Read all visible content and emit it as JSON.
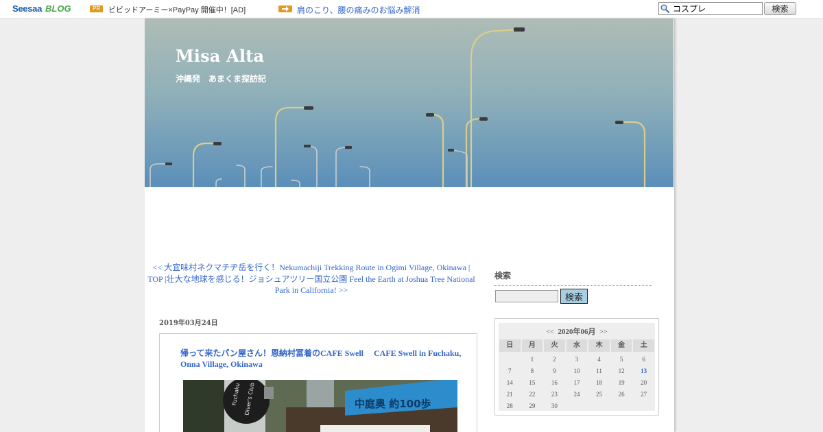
{
  "topbar": {
    "logo_seesaa": "Seesaa",
    "logo_blog": "BLOG",
    "pr_badge": "PR",
    "ad_text": "ビビッドアーミー×PayPay 開催中！[AD]",
    "ad_link": "肩のこり、腰の痛みのお悩み解消",
    "search_value": "コスプレ",
    "search_button": "検索"
  },
  "header": {
    "title": "Misa Alta",
    "description": "沖縄発　あまくま探訪記"
  },
  "nav": {
    "prev": "<< 大宜味村ネクマチヂ岳を行く！Nekumachiji Trekking Route in Ogimi Village, Okinawa",
    "sep1": " | ",
    "top": "TOP",
    "sep2": " |",
    "next": "壮大な地球を感じる！ジョシュアツリー国立公園 Feel the Earth at Joshua Tree National Park in California! >>"
  },
  "post": {
    "date": "2019年03月24日",
    "title": "帰って来たパン屋さん！恩納村冨着のCAFE Swell　 CAFE Swell in Fuchaku, Onna Village, Okinawa",
    "sign_text": "中庭奥 約100歩"
  },
  "sidebar": {
    "search_heading": "検索",
    "search_button": "検索",
    "calendar": {
      "prev": "<<",
      "month": "2020年06月",
      "next": ">>",
      "weekdays": [
        "日",
        "月",
        "火",
        "水",
        "木",
        "金",
        "土"
      ],
      "weeks": [
        [
          "",
          "1",
          "2",
          "3",
          "4",
          "5",
          "6"
        ],
        [
          "7",
          "8",
          "9",
          "10",
          "11",
          "12",
          "13"
        ],
        [
          "14",
          "15",
          "16",
          "17",
          "18",
          "19",
          "20"
        ],
        [
          "21",
          "22",
          "23",
          "24",
          "25",
          "26",
          "27"
        ],
        [
          "28",
          "29",
          "30",
          "",
          "",
          "",
          ""
        ]
      ],
      "linked_day": "13"
    }
  },
  "colors": {
    "link": "#3366cc",
    "accent": "#e09a1e",
    "sky_top": "#a9b9b6",
    "sky_bottom": "#5f91b8"
  }
}
